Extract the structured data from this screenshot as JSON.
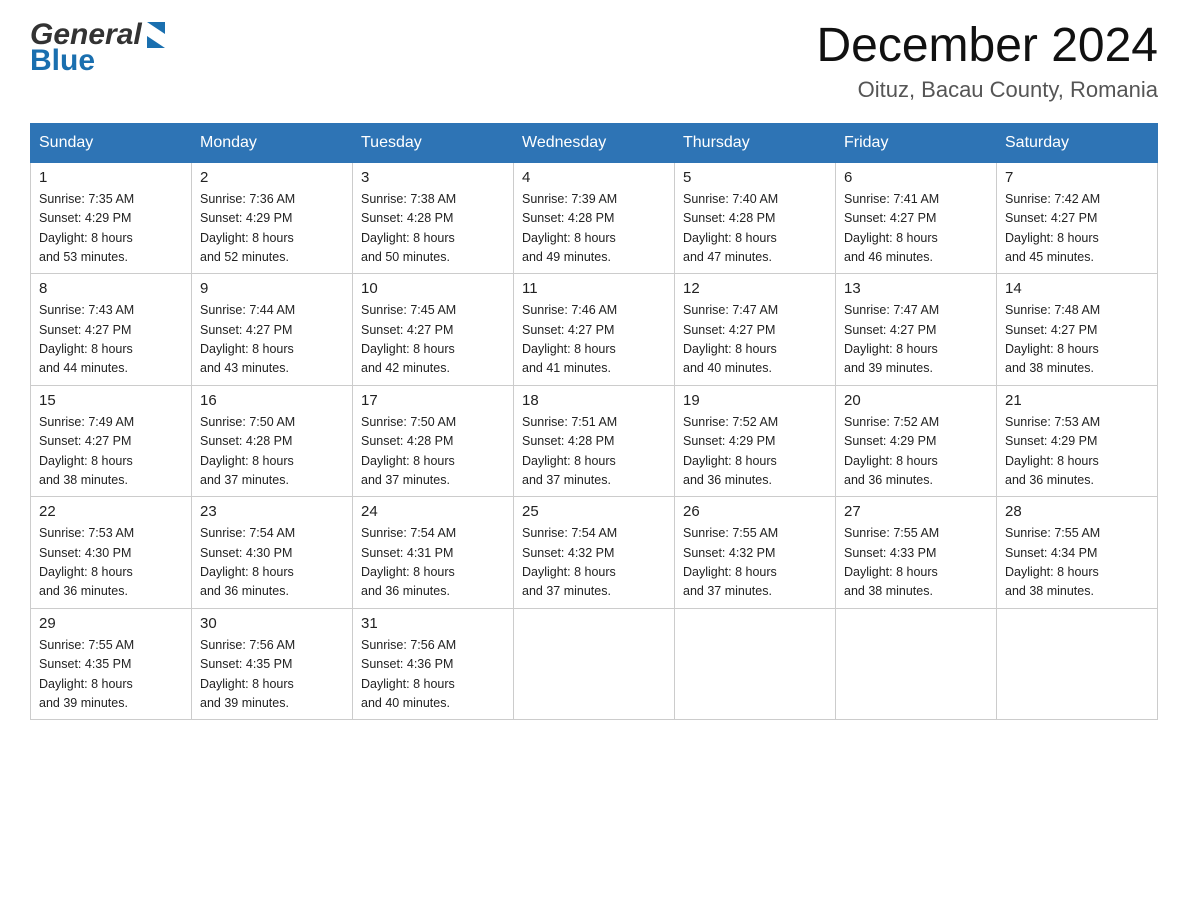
{
  "header": {
    "month_title": "December 2024",
    "location": "Oituz, Bacau County, Romania",
    "logo_general": "General",
    "logo_blue": "Blue"
  },
  "weekdays": [
    "Sunday",
    "Monday",
    "Tuesday",
    "Wednesday",
    "Thursday",
    "Friday",
    "Saturday"
  ],
  "weeks": [
    [
      {
        "day": "1",
        "sunrise": "7:35 AM",
        "sunset": "4:29 PM",
        "daylight": "8 hours and 53 minutes."
      },
      {
        "day": "2",
        "sunrise": "7:36 AM",
        "sunset": "4:29 PM",
        "daylight": "8 hours and 52 minutes."
      },
      {
        "day": "3",
        "sunrise": "7:38 AM",
        "sunset": "4:28 PM",
        "daylight": "8 hours and 50 minutes."
      },
      {
        "day": "4",
        "sunrise": "7:39 AM",
        "sunset": "4:28 PM",
        "daylight": "8 hours and 49 minutes."
      },
      {
        "day": "5",
        "sunrise": "7:40 AM",
        "sunset": "4:28 PM",
        "daylight": "8 hours and 47 minutes."
      },
      {
        "day": "6",
        "sunrise": "7:41 AM",
        "sunset": "4:27 PM",
        "daylight": "8 hours and 46 minutes."
      },
      {
        "day": "7",
        "sunrise": "7:42 AM",
        "sunset": "4:27 PM",
        "daylight": "8 hours and 45 minutes."
      }
    ],
    [
      {
        "day": "8",
        "sunrise": "7:43 AM",
        "sunset": "4:27 PM",
        "daylight": "8 hours and 44 minutes."
      },
      {
        "day": "9",
        "sunrise": "7:44 AM",
        "sunset": "4:27 PM",
        "daylight": "8 hours and 43 minutes."
      },
      {
        "day": "10",
        "sunrise": "7:45 AM",
        "sunset": "4:27 PM",
        "daylight": "8 hours and 42 minutes."
      },
      {
        "day": "11",
        "sunrise": "7:46 AM",
        "sunset": "4:27 PM",
        "daylight": "8 hours and 41 minutes."
      },
      {
        "day": "12",
        "sunrise": "7:47 AM",
        "sunset": "4:27 PM",
        "daylight": "8 hours and 40 minutes."
      },
      {
        "day": "13",
        "sunrise": "7:47 AM",
        "sunset": "4:27 PM",
        "daylight": "8 hours and 39 minutes."
      },
      {
        "day": "14",
        "sunrise": "7:48 AM",
        "sunset": "4:27 PM",
        "daylight": "8 hours and 38 minutes."
      }
    ],
    [
      {
        "day": "15",
        "sunrise": "7:49 AM",
        "sunset": "4:27 PM",
        "daylight": "8 hours and 38 minutes."
      },
      {
        "day": "16",
        "sunrise": "7:50 AM",
        "sunset": "4:28 PM",
        "daylight": "8 hours and 37 minutes."
      },
      {
        "day": "17",
        "sunrise": "7:50 AM",
        "sunset": "4:28 PM",
        "daylight": "8 hours and 37 minutes."
      },
      {
        "day": "18",
        "sunrise": "7:51 AM",
        "sunset": "4:28 PM",
        "daylight": "8 hours and 37 minutes."
      },
      {
        "day": "19",
        "sunrise": "7:52 AM",
        "sunset": "4:29 PM",
        "daylight": "8 hours and 36 minutes."
      },
      {
        "day": "20",
        "sunrise": "7:52 AM",
        "sunset": "4:29 PM",
        "daylight": "8 hours and 36 minutes."
      },
      {
        "day": "21",
        "sunrise": "7:53 AM",
        "sunset": "4:29 PM",
        "daylight": "8 hours and 36 minutes."
      }
    ],
    [
      {
        "day": "22",
        "sunrise": "7:53 AM",
        "sunset": "4:30 PM",
        "daylight": "8 hours and 36 minutes."
      },
      {
        "day": "23",
        "sunrise": "7:54 AM",
        "sunset": "4:30 PM",
        "daylight": "8 hours and 36 minutes."
      },
      {
        "day": "24",
        "sunrise": "7:54 AM",
        "sunset": "4:31 PM",
        "daylight": "8 hours and 36 minutes."
      },
      {
        "day": "25",
        "sunrise": "7:54 AM",
        "sunset": "4:32 PM",
        "daylight": "8 hours and 37 minutes."
      },
      {
        "day": "26",
        "sunrise": "7:55 AM",
        "sunset": "4:32 PM",
        "daylight": "8 hours and 37 minutes."
      },
      {
        "day": "27",
        "sunrise": "7:55 AM",
        "sunset": "4:33 PM",
        "daylight": "8 hours and 38 minutes."
      },
      {
        "day": "28",
        "sunrise": "7:55 AM",
        "sunset": "4:34 PM",
        "daylight": "8 hours and 38 minutes."
      }
    ],
    [
      {
        "day": "29",
        "sunrise": "7:55 AM",
        "sunset": "4:35 PM",
        "daylight": "8 hours and 39 minutes."
      },
      {
        "day": "30",
        "sunrise": "7:56 AM",
        "sunset": "4:35 PM",
        "daylight": "8 hours and 39 minutes."
      },
      {
        "day": "31",
        "sunrise": "7:56 AM",
        "sunset": "4:36 PM",
        "daylight": "8 hours and 40 minutes."
      },
      null,
      null,
      null,
      null
    ]
  ],
  "labels": {
    "sunrise": "Sunrise:",
    "sunset": "Sunset:",
    "daylight": "Daylight:"
  }
}
